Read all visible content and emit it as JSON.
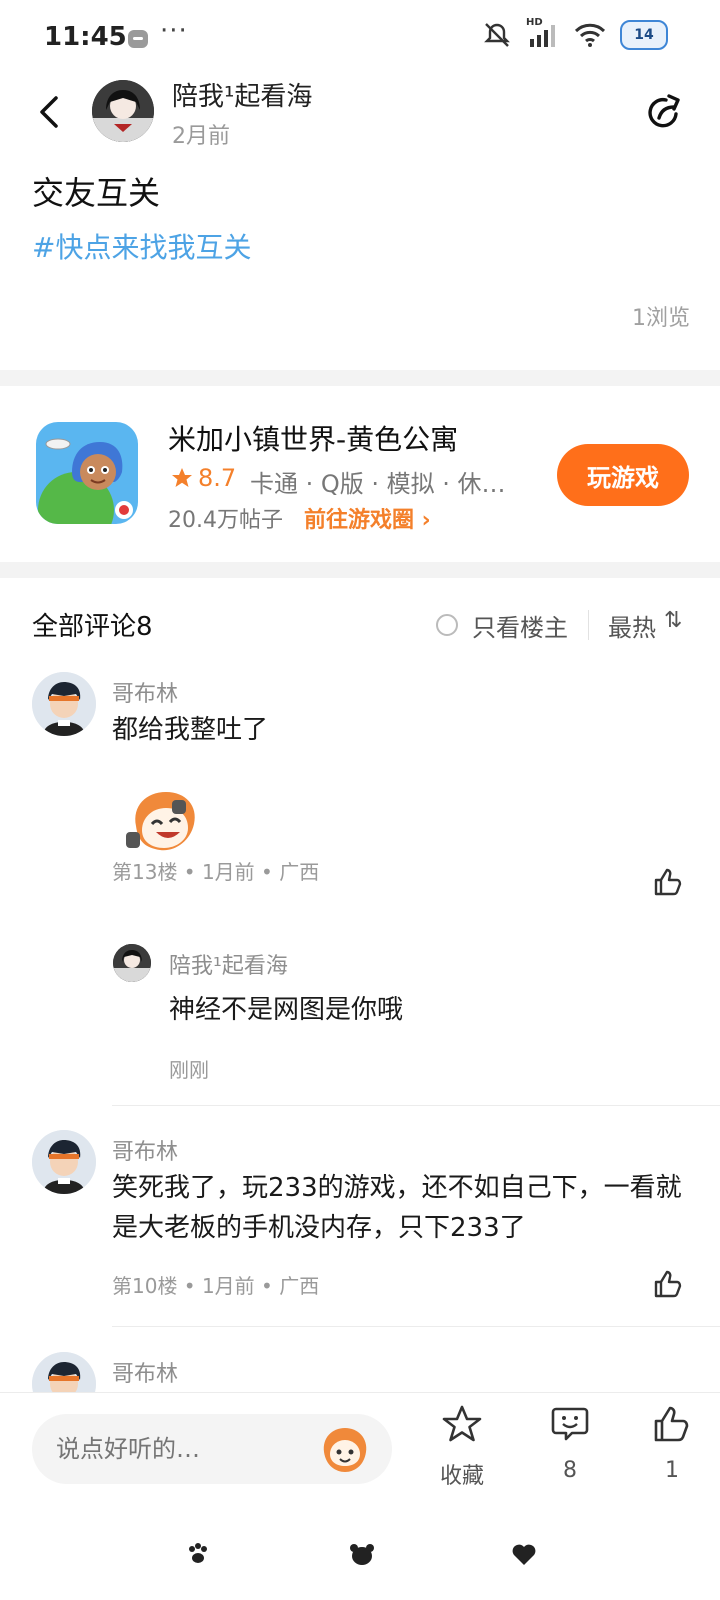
{
  "status_bar": {
    "time": "11:45",
    "more": "···",
    "hd_label": "HD",
    "battery": "14"
  },
  "header": {
    "author": "陪我¹起看海",
    "time": "2月前"
  },
  "post": {
    "title": "交友互关",
    "tag": "#快点来找我互关",
    "views": "1浏览"
  },
  "game_card": {
    "name": "米加小镇世界-黄色公寓",
    "rating": "8.7",
    "tags": "卡通 · Q版 · 模拟 · 休…",
    "posts": "20.4万帖子",
    "goto": "前往游戏圈 ›",
    "play": "玩游戏"
  },
  "comments_header": {
    "title": "全部评论8",
    "only_op": "只看楼主",
    "sort": "最热",
    "sort_icon": "⇅"
  },
  "comments": [
    {
      "user": "哥布林",
      "text": "都给我整吐了",
      "meta": "第13楼 • 1月前 • 广西"
    },
    {
      "user": "哥布林",
      "text": "笑死我了，玩233的游戏，还不如自己下，一看就是大老板的手机没内存，只下233了",
      "meta": "第10楼 • 1月前 • 广西"
    },
    {
      "user": "哥布林"
    }
  ],
  "reply": {
    "user": "陪我¹起看海",
    "text": "神经不是网图是你哦",
    "time": "刚刚"
  },
  "bottom_bar": {
    "placeholder": "说点好听的…",
    "favorite": "收藏",
    "comments_count": "8",
    "likes_count": "1"
  },
  "colors": {
    "accent": "#ff6f1a",
    "tag_blue": "#4da3e5",
    "rating_orange": "#f4802b"
  }
}
